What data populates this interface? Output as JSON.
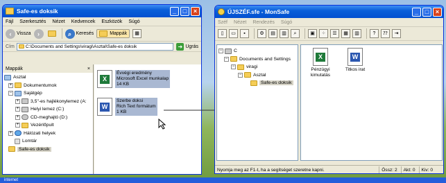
{
  "desktop": {
    "taskbar_label": "internet"
  },
  "left_window": {
    "title": "Safe-es doksik",
    "menu": [
      "Fájl",
      "Szerkesztés",
      "Nézet",
      "Kedvencek",
      "Eszközök",
      "Súgó"
    ],
    "toolbar": {
      "back": "Vissza",
      "search": "Keresés",
      "folders": "Mappák",
      "forward": "›",
      "view": "▦"
    },
    "address": {
      "label": "Cím",
      "value": "C:\\Documents and Settings\\viragi\\Asztal\\Safe-es doksik",
      "go": "Ugrás"
    },
    "folders_pane": {
      "title": "Mappák",
      "close": "×",
      "items": [
        {
          "label": "Asztal"
        },
        {
          "label": "Dokumentumok"
        },
        {
          "label": "Sajátgép"
        },
        {
          "label": "3,5\"-es hajlékonylemez (A:"
        },
        {
          "label": "Helyi lemez (C:)"
        },
        {
          "label": "CD-meghajtó (D:)"
        },
        {
          "label": "Vezérlőpult"
        },
        {
          "label": "Hálózati helyek"
        },
        {
          "label": "Lomtár"
        },
        {
          "label": "Safe-es doksik"
        }
      ]
    },
    "files": [
      {
        "name": "Évvégi eredmény",
        "type": "Microsoft Excel munkalap",
        "size": "14 KB",
        "icon": "excel-icon"
      },
      {
        "name": "Szerbe doksi",
        "type": "Rich Text formátum",
        "size": "1 KB",
        "icon": "word-icon"
      }
    ]
  },
  "right_window": {
    "title": "ÚJSZÉF.sfe - MonSafe",
    "menu": [
      "Széf",
      "Nézet",
      "Rendezés",
      "Súgó"
    ],
    "tree": [
      {
        "label": "C"
      },
      {
        "label": "Documents and Settings"
      },
      {
        "label": "viragi"
      },
      {
        "label": "Asztal"
      },
      {
        "label": "Safe-es doksik"
      }
    ],
    "files": [
      {
        "name": "Pénzügyi kimutatás",
        "icon": "excel-icon"
      },
      {
        "name": "Titkos irat",
        "icon": "word-icon"
      }
    ],
    "status": {
      "help": "Nyomja meg az F1-t, ha a segítséget szeretne kapni.",
      "total": "Össz: 2",
      "active": "Akt: 0",
      "selected": "Kiv: 0"
    }
  },
  "colors": {
    "title_blue": "#0a5fd9",
    "selection": "#316ac5",
    "window_face": "#ece9d8"
  }
}
